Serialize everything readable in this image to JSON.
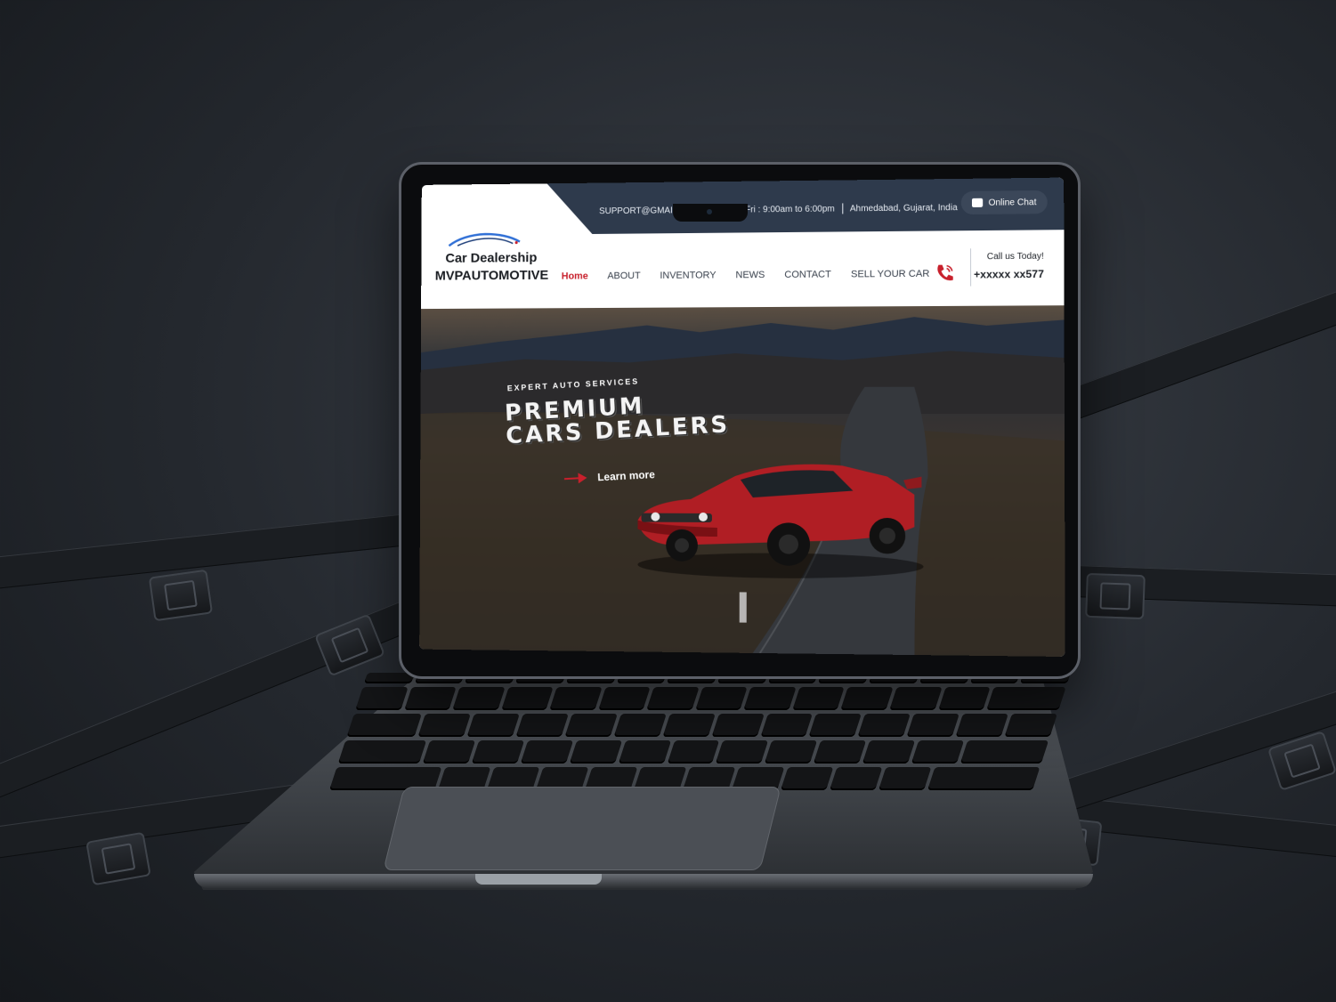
{
  "topbar": {
    "email": "SUPPORT@GMAIL.COM",
    "hours": "Mon to Fri : 9:00am to 6:00pm",
    "location": "Ahmedabad, Gujarat, India",
    "chat_label": "Online Chat"
  },
  "header": {
    "brand_line1": "Car Dealership",
    "brand_line2": "MVPAUTOMOTIVE",
    "nav": [
      "Home",
      "ABOUT",
      "INVENTORY",
      "NEWS",
      "CONTACT",
      "SELL YOUR CAR"
    ],
    "call_label": "Call us Today!",
    "call_number": "+xxxxx xx577"
  },
  "hero": {
    "kicker": "EXPERT AUTO SERVICES",
    "title_line1": "PREMIUM",
    "title_line2": "CARS DEALERS",
    "cta_label": "Learn more"
  },
  "icons": {
    "logo": "car-silhouette-logo-icon",
    "chat": "chat-bubble-icon",
    "phone": "phone-icon",
    "cta": "arrow-right-icon"
  },
  "colors": {
    "accent": "#c8202c",
    "topbar": "#2e3a4c"
  }
}
